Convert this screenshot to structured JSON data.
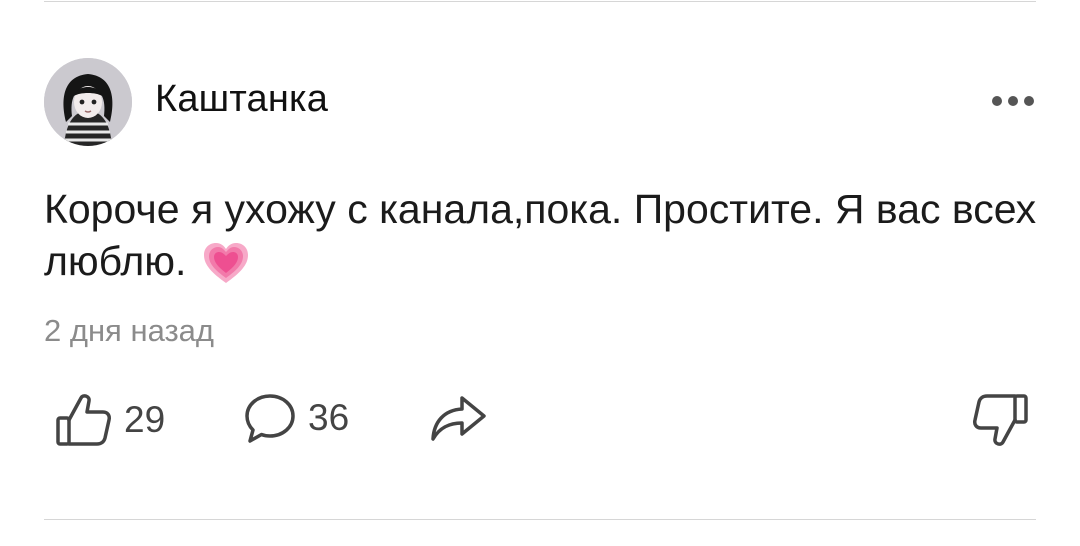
{
  "post": {
    "author": "Каштанка",
    "text": "Короче я ухожу с канала,пока. Простите. Я вас всех люблю.",
    "emoji": "💗",
    "time": "2 дня назад"
  },
  "actions": {
    "likes": "29",
    "comments": "36"
  },
  "icons": {
    "more": "more-dots-icon",
    "like": "thumbs-up-icon",
    "comment": "comment-bubble-icon",
    "share": "share-arrow-icon",
    "dislike": "thumbs-down-icon",
    "emoji": "pink-heart-icon"
  },
  "colors": {
    "icon": "#444444",
    "secondary_text": "#8b8b8b",
    "heart": "#f45c9b"
  }
}
